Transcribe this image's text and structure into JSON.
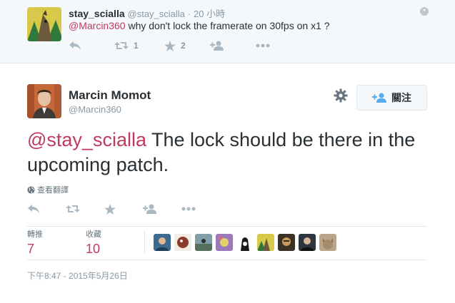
{
  "parent_tweet": {
    "name": "stay_scialla",
    "handle": "@stay_scialla",
    "separator": "·",
    "time": "20 小時",
    "mention": "@Marcin360",
    "text": "why don't lock the framerate on 30fps on x1 ?",
    "retweet_count": "1",
    "like_count": "2",
    "icons": [
      "reply-icon",
      "retweet-icon",
      "star-icon",
      "follow-icon",
      "more-icon",
      "caret-down-icon"
    ]
  },
  "main_tweet": {
    "name": "Marcin Momot",
    "handle": "@Marcin360",
    "follow_label": "關注",
    "mention": "@stay_scialla",
    "text": " The lock should be there in the upcoming patch.",
    "translate_label": "查看翻譯",
    "stats": {
      "retweets_label": "轉推",
      "retweets_value": "7",
      "likes_label": "收藏",
      "likes_value": "10"
    },
    "timestamp": "下午8:47 - 2015年5月26日",
    "icons": [
      "gear-icon",
      "add-user-icon",
      "globe-icon",
      "reply-icon",
      "retweet-icon",
      "star-icon",
      "follow-icon",
      "more-icon"
    ]
  },
  "colors": {
    "accent": "#c0395f",
    "muted": "#8899a6",
    "icon": "#aab8c2",
    "text": "#292f33",
    "bg_parent": "#f5f8fa"
  }
}
